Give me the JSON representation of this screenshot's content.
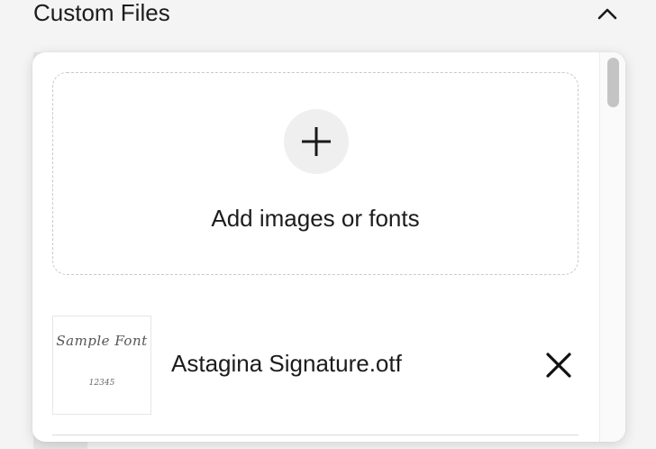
{
  "section": {
    "title": "Custom Files",
    "toggle_icon": "chevron-up-icon"
  },
  "dropzone": {
    "label": "Add images or fonts",
    "icon": "plus-icon"
  },
  "files": [
    {
      "name": "Astagina Signature.otf",
      "preview_text": "Sample Font",
      "preview_numbers": "12345",
      "remove_icon": "close-icon"
    }
  ],
  "scrollbar": {
    "position": 0
  }
}
